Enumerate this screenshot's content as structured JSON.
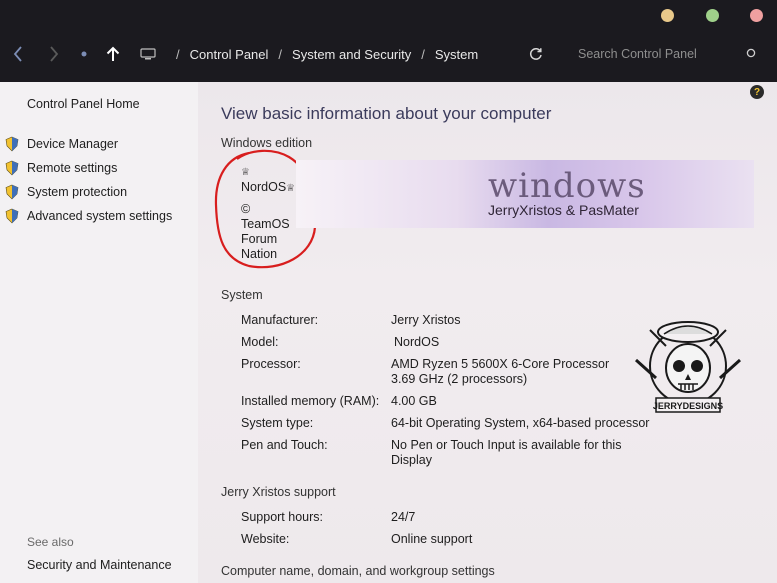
{
  "window": {
    "colors": {
      "minimize": "#e8c88a",
      "maximize": "#9fd08a",
      "close": "#f0a0a0"
    }
  },
  "toolbar": {
    "back_icon": "chevron-left-icon",
    "forward_icon": "chevron-right-icon",
    "up_icon": "arrow-up-icon",
    "refresh_icon": "refresh-icon",
    "breadcrumbs": [
      "Control Panel",
      "System and Security",
      "System"
    ],
    "search_placeholder": "Search Control Panel"
  },
  "sidebar": {
    "home": "Control Panel Home",
    "items": [
      {
        "label": "Device Manager",
        "icon": "shield-icon"
      },
      {
        "label": "Remote settings",
        "icon": "shield-icon"
      },
      {
        "label": "System protection",
        "icon": "shield-icon"
      },
      {
        "label": "Advanced system settings",
        "icon": "shield-icon"
      }
    ],
    "see_also": "See also",
    "see_also_link": "Security and Maintenance"
  },
  "main": {
    "title": "View basic information about your computer",
    "edition": {
      "heading": "Windows edition",
      "crown": "♕",
      "name": "NordOS",
      "copyright": "©",
      "owner_lines": [
        "TeamOS",
        "Forum",
        "Nation"
      ],
      "banner_logo": "windows",
      "banner_sub": "JerryXristos & PasMater"
    },
    "system": {
      "heading": "System",
      "rows": [
        {
          "label": "Manufacturer:",
          "value": "Jerry Xristos"
        },
        {
          "label": "Model:",
          "value": "NordOS"
        },
        {
          "label": "Processor:",
          "value": "AMD Ryzen 5 5600X 6-Core Processor",
          "value2": "3.69 GHz  (2 processors)"
        },
        {
          "label": "Installed memory (RAM):",
          "value": "4.00 GB"
        },
        {
          "label": "System type:",
          "value": "64-bit Operating System, x64-based processor"
        },
        {
          "label": "Pen and Touch:",
          "value": "No Pen or Touch Input is available for this",
          "value2": "Display"
        }
      ],
      "logo_text": "JERRYDESIGNS"
    },
    "support": {
      "heading": "Jerry Xristos support",
      "rows": [
        {
          "label": "Support hours:",
          "value": "24/7"
        },
        {
          "label": "Website:",
          "value": "Online support"
        }
      ]
    },
    "computer_heading": "Computer name, domain, and workgroup settings",
    "help": "?"
  }
}
